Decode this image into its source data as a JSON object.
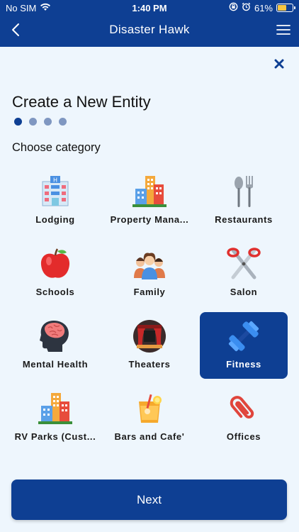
{
  "status_bar": {
    "carrier": "No SIM",
    "time": "1:40 PM",
    "battery_percent": "61%",
    "battery_level": 0.61,
    "icons": [
      "wifi-icon",
      "orientation-lock-icon",
      "alarm-icon",
      "battery-icon"
    ]
  },
  "header": {
    "title": "Disaster Hawk",
    "back_icon": "chevron-left-icon",
    "menu_icon": "hamburger-menu-icon"
  },
  "close_icon": "close-icon",
  "page": {
    "title": "Create a New Entity",
    "steps_total": 4,
    "current_step": 1,
    "subtitle": "Choose category"
  },
  "categories": [
    {
      "label": "Lodging",
      "icon": "hotel-icon",
      "selected": false
    },
    {
      "label": "Property Mana...",
      "icon": "buildings-icon",
      "selected": false
    },
    {
      "label": "Restaurants",
      "icon": "fork-spoon-icon",
      "selected": false
    },
    {
      "label": "Schools",
      "icon": "apple-icon",
      "selected": false
    },
    {
      "label": "Family",
      "icon": "family-icon",
      "selected": false
    },
    {
      "label": "Salon",
      "icon": "scissors-icon",
      "selected": false
    },
    {
      "label": "Mental Health",
      "icon": "brain-head-icon",
      "selected": false
    },
    {
      "label": "Theaters",
      "icon": "theater-stage-icon",
      "selected": false
    },
    {
      "label": "Fitness",
      "icon": "dumbbell-icon",
      "selected": true
    },
    {
      "label": "RV Parks (Cust...",
      "icon": "buildings-icon",
      "selected": false
    },
    {
      "label": "Bars and Cafe'",
      "icon": "drink-icon",
      "selected": false
    },
    {
      "label": "Offices",
      "icon": "paperclip-icon",
      "selected": false
    }
  ],
  "next_button": {
    "label": "Next"
  },
  "colors": {
    "primary": "#0e3f93",
    "background": "#eef6fd",
    "step_inactive": "#7f97c1"
  }
}
